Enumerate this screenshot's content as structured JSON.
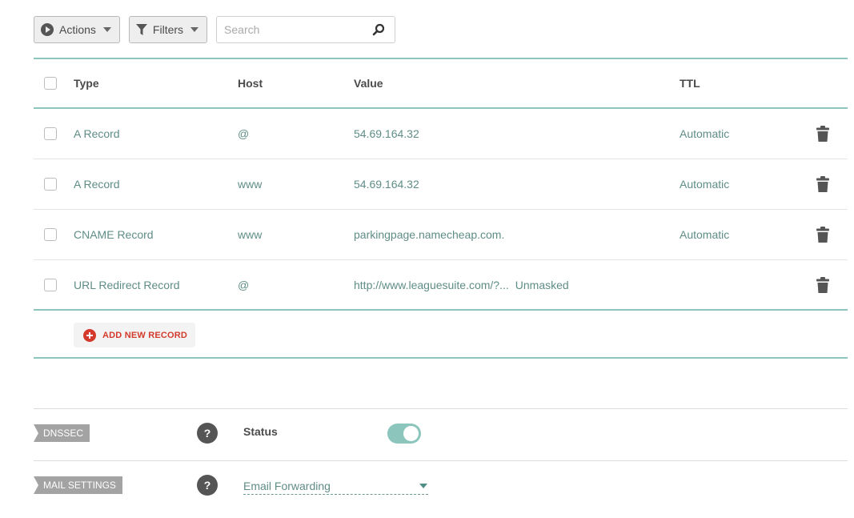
{
  "toolbar": {
    "actions_label": "Actions",
    "filters_label": "Filters",
    "search_placeholder": "Search"
  },
  "table": {
    "headers": {
      "type": "Type",
      "host": "Host",
      "value": "Value",
      "ttl": "TTL"
    },
    "rows": [
      {
        "type": "A Record",
        "host": "@",
        "value": "54.69.164.32",
        "extra": "",
        "ttl": "Automatic"
      },
      {
        "type": "A Record",
        "host": "www",
        "value": "54.69.164.32",
        "extra": "",
        "ttl": "Automatic"
      },
      {
        "type": "CNAME Record",
        "host": "www",
        "value": "parkingpage.namecheap.com.",
        "extra": "",
        "ttl": "Automatic"
      },
      {
        "type": "URL Redirect Record",
        "host": "@",
        "value": "http://www.leaguesuite.com/?...",
        "extra": "Unmasked",
        "ttl": ""
      }
    ],
    "add_label": "ADD NEW RECORD"
  },
  "dnssec": {
    "tag": "DNSSEC",
    "help": "?",
    "status_label": "Status",
    "enabled": true
  },
  "mail": {
    "tag": "MAIL SETTINGS",
    "help": "?",
    "selected": "Email Forwarding"
  },
  "colors": {
    "accent": "#8cc5bc",
    "link": "#5f8d86",
    "add": "#d33a2c"
  },
  "icons": {
    "actions": "play-circle-icon",
    "filters": "funnel-icon",
    "search": "magnifier-icon",
    "delete": "trash-icon",
    "add": "plus-circle-icon",
    "help": "question-icon"
  }
}
